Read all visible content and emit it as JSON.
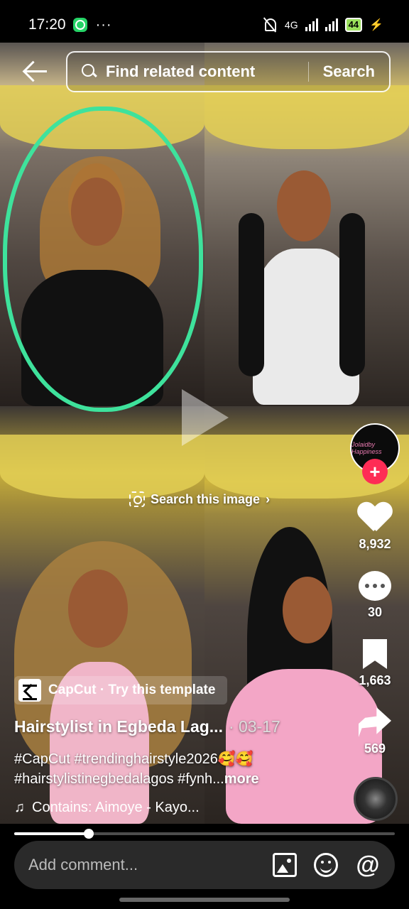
{
  "status": {
    "time": "17:20",
    "more": "···",
    "network": "4G",
    "battery": "44"
  },
  "search": {
    "placeholder": "Find related content",
    "button": "Search"
  },
  "overlay": {
    "search_image": "Search this image"
  },
  "creator": {
    "avatar_text": "Jolaidby Happiness"
  },
  "actions": {
    "likes": "8,932",
    "comments": "30",
    "saves": "1,663",
    "shares": "569"
  },
  "caption": {
    "capcut_label": "CapCut · Try this template",
    "title": "Hairstylist in Egbeda Lag...",
    "date": "· 03-17",
    "hashtags_line1": "#CapCut #trendinghairstyle2026🥰🥰",
    "hashtags_line2": "#hairstylistinegbedalagos #fynh...",
    "more": "more",
    "music": "Contains: Aimoye - Kayo..."
  },
  "progress": {
    "fraction": 0.195
  },
  "comment": {
    "placeholder": "Add comment..."
  },
  "colors": {
    "highlight": "#3ee29c",
    "follow": "#fe2c55",
    "battery": "#9be15d"
  },
  "icons": [
    "back-arrow-icon",
    "search-icon",
    "lens-icon",
    "heart-icon",
    "comment-icon",
    "bookmark-icon",
    "share-icon",
    "music-note-icon",
    "image-icon",
    "emoji-icon",
    "mention-icon"
  ]
}
